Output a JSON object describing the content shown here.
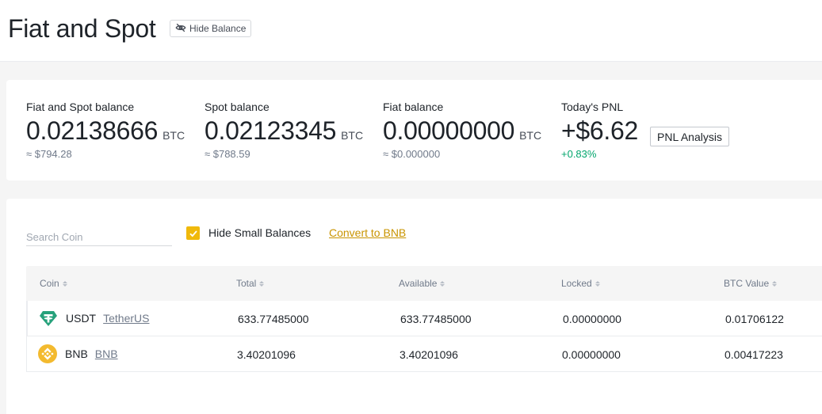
{
  "header": {
    "title": "Fiat and Spot",
    "hide_balance_label": "Hide Balance"
  },
  "balances": [
    {
      "label": "Fiat and Spot balance",
      "value": "0.02138666",
      "unit": "BTC",
      "sub": "≈ $794.28"
    },
    {
      "label": "Spot balance",
      "value": "0.02123345",
      "unit": "BTC",
      "sub": "≈ $788.59"
    },
    {
      "label": "Fiat balance",
      "value": "0.00000000",
      "unit": "BTC",
      "sub": "≈ $0.000000"
    },
    {
      "label": "Today's PNL",
      "value": "+$6.62",
      "unit": "",
      "sub": "+0.83%"
    }
  ],
  "pnl_button_label": "PNL Analysis",
  "filters": {
    "search_placeholder": "Search Coin",
    "hide_small_label": "Hide Small Balances",
    "hide_small_checked": true,
    "convert_label": "Convert to BNB"
  },
  "table": {
    "columns": [
      "Coin",
      "Total",
      "Available",
      "Locked",
      "BTC Value"
    ],
    "rows": [
      {
        "symbol": "USDT",
        "name": "TetherUS",
        "icon": "usdt-icon",
        "color": "#26a17b",
        "total": "633.77485000",
        "available": "633.77485000",
        "locked": "0.00000000",
        "btc_value": "0.01706122"
      },
      {
        "symbol": "BNB",
        "name": "BNB",
        "icon": "bnb-icon",
        "color": "#f3ba2f",
        "total": "3.40201096",
        "available": "3.40201096",
        "locked": "0.00000000",
        "btc_value": "0.00417223"
      }
    ]
  },
  "colors": {
    "accent": "#f0b90b",
    "link": "#c99400",
    "positive": "#03a66d"
  }
}
